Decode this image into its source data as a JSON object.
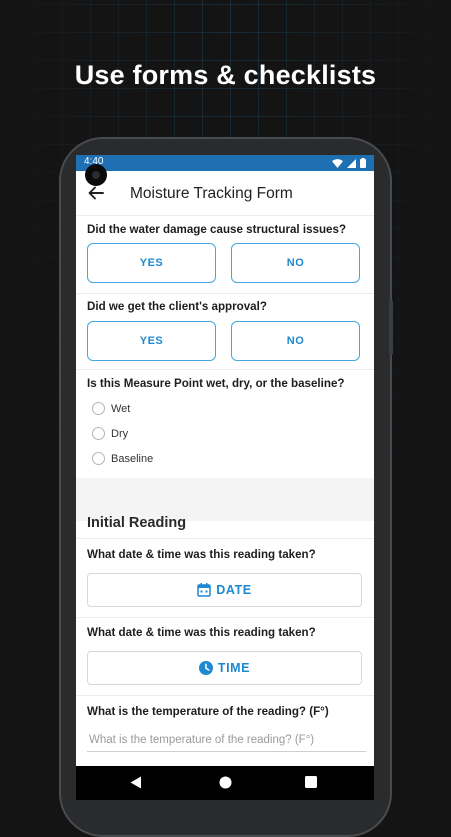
{
  "promo": {
    "headline": "Use forms & checklists"
  },
  "status_bar": {
    "time": "4:40"
  },
  "app_bar": {
    "title": "Moisture Tracking Form"
  },
  "form": {
    "q1": {
      "label": "Did the water damage cause structural issues?",
      "yes": "YES",
      "no": "NO"
    },
    "q2": {
      "label": "Did we get the client's approval?",
      "yes": "YES",
      "no": "NO"
    },
    "q3": {
      "label": "Is this Measure Point wet, dry, or the baseline?",
      "options": [
        "Wet",
        "Dry",
        "Baseline"
      ]
    },
    "section": {
      "title": "Initial Reading"
    },
    "q4": {
      "label": "What date & time was this reading taken?",
      "button": "DATE"
    },
    "q5": {
      "label": "What date & time was this reading taken?",
      "button": "TIME"
    },
    "q6": {
      "label": "What is the temperature of the reading? (F°)",
      "placeholder": "What is the temperature of the reading? (F°)"
    }
  },
  "colors": {
    "accent": "#1e88d0",
    "status_bar": "#1f6fb3",
    "outline": "#46a6e3"
  },
  "icons": {
    "back": "arrow-left-icon",
    "date": "calendar-icon",
    "time": "clock-icon",
    "nav": [
      "back-triangle-icon",
      "home-circle-icon",
      "recents-square-icon"
    ]
  }
}
